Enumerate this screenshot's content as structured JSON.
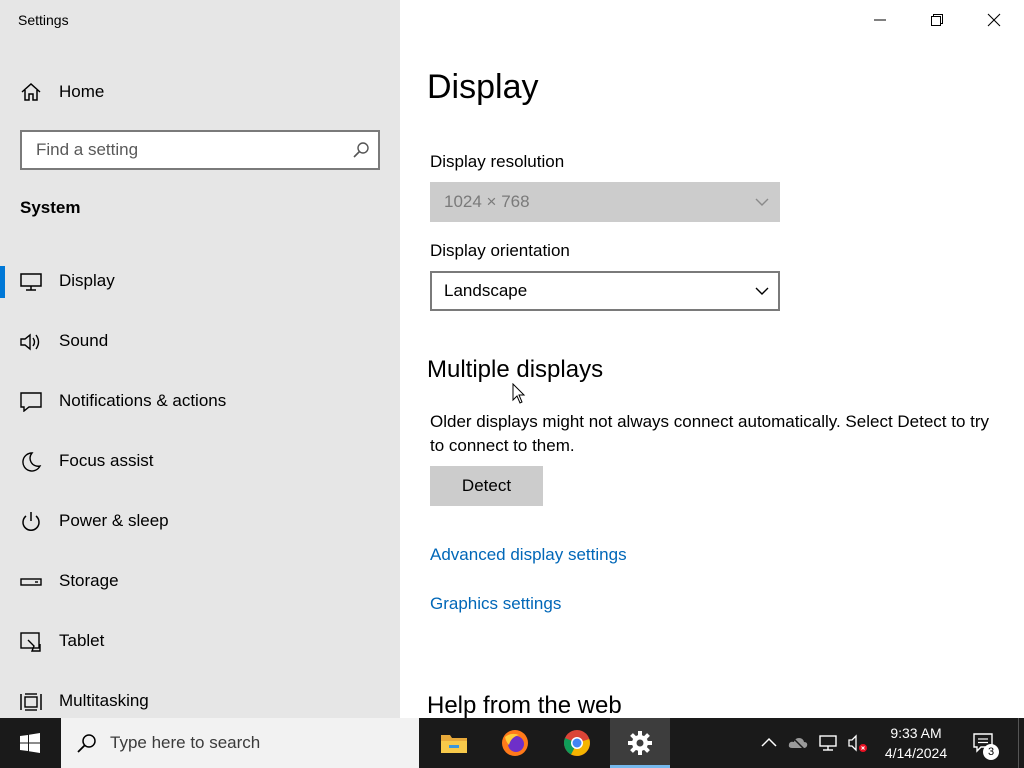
{
  "window": {
    "title": "Settings",
    "controls": {
      "minimize": "minimize-icon",
      "maximize": "restore-icon",
      "close": "close-icon"
    }
  },
  "sidebar": {
    "home_label": "Home",
    "search_placeholder": "Find a setting",
    "section": "System",
    "items": [
      {
        "label": "Display",
        "icon": "monitor-icon",
        "selected": true
      },
      {
        "label": "Sound",
        "icon": "speaker-icon",
        "selected": false
      },
      {
        "label": "Notifications & actions",
        "icon": "message-icon",
        "selected": false
      },
      {
        "label": "Focus assist",
        "icon": "moon-icon",
        "selected": false
      },
      {
        "label": "Power & sleep",
        "icon": "power-icon",
        "selected": false
      },
      {
        "label": "Storage",
        "icon": "drive-icon",
        "selected": false
      },
      {
        "label": "Tablet",
        "icon": "tablet-icon",
        "selected": false
      },
      {
        "label": "Multitasking",
        "icon": "multitasking-icon",
        "selected": false
      }
    ]
  },
  "main": {
    "title": "Display",
    "resolution": {
      "label": "Display resolution",
      "value": "1024 × 768",
      "disabled": true
    },
    "orientation": {
      "label": "Display orientation",
      "value": "Landscape"
    },
    "multiple_displays": {
      "heading": "Multiple displays",
      "description": "Older displays might not always connect automatically. Select Detect to try to connect to them.",
      "detect_label": "Detect"
    },
    "links": {
      "advanced": "Advanced display settings",
      "graphics": "Graphics settings"
    },
    "help_heading": "Help from the web"
  },
  "taskbar": {
    "search_placeholder": "Type here to search",
    "apps": [
      "file-explorer-icon",
      "firefox-icon",
      "chrome-icon",
      "settings-gear-icon"
    ],
    "time": "9:33 AM",
    "date": "4/14/2024",
    "notification_count": "3"
  },
  "colors": {
    "accent": "#0078d7",
    "link": "#0067b8",
    "sidebar_bg": "#e6e6e6",
    "taskbar_bg": "#1a1a1a"
  }
}
